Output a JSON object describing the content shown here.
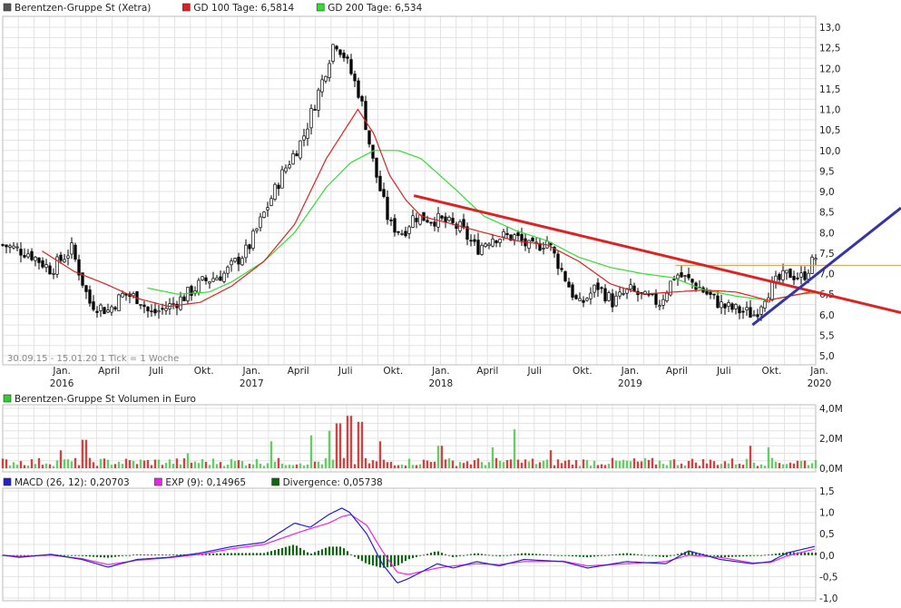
{
  "price_panel": {
    "legend": [
      {
        "label": "Berentzen-Gruppe St (Xetra)",
        "color": "#555555"
      },
      {
        "label": "GD 100 Tage: 6,5814",
        "color": "#e02020"
      },
      {
        "label": "GD 200 Tage: 6,534",
        "color": "#33dd33"
      }
    ],
    "y_ticks": [
      "13,0",
      "12,5",
      "12,0",
      "11,5",
      "11,0",
      "10,5",
      "10,0",
      "9,5",
      "9,0",
      "8,5",
      "8,0",
      "7,5",
      "7,0",
      "6,5",
      "6,0",
      "5,5",
      "5,0"
    ],
    "footer": "30.09.15 - 15.01.20   1 Tick = 1 Woche",
    "x_ticks": [
      {
        "label": "Jan.",
        "year": "2016"
      },
      {
        "label": "April",
        "year": ""
      },
      {
        "label": "Juli",
        "year": ""
      },
      {
        "label": "Okt.",
        "year": ""
      },
      {
        "label": "Jan.",
        "year": "2017"
      },
      {
        "label": "April",
        "year": ""
      },
      {
        "label": "Juli",
        "year": ""
      },
      {
        "label": "Okt.",
        "year": ""
      },
      {
        "label": "Jan.",
        "year": "2018"
      },
      {
        "label": "April",
        "year": ""
      },
      {
        "label": "Juli",
        "year": ""
      },
      {
        "label": "Okt.",
        "year": ""
      },
      {
        "label": "Jan.",
        "year": "2019"
      },
      {
        "label": "April",
        "year": ""
      },
      {
        "label": "Juli",
        "year": ""
      },
      {
        "label": "Okt.",
        "year": ""
      },
      {
        "label": "Jan.",
        "year": "2020"
      }
    ]
  },
  "volume_panel": {
    "legend": [
      {
        "label": "Berentzen-Gruppe St Volumen in Euro",
        "color": "#33cc33"
      }
    ],
    "y_ticks": [
      "4,0M",
      "2,0M",
      "0,0M"
    ]
  },
  "macd_panel": {
    "legend": [
      {
        "label": "MACD (26, 12): 0,20703",
        "color": "#2222cc"
      },
      {
        "label": "EXP (9): 0,14965",
        "color": "#ee22ee"
      },
      {
        "label": "Divergence: 0,05738",
        "color": "#116611"
      }
    ],
    "y_ticks": [
      "1,5",
      "1,0",
      "0,5",
      "0,0",
      "-0,5",
      "-1,0"
    ]
  },
  "chart_data": [
    {
      "type": "candlestick",
      "title": "Berentzen-Gruppe St (Xetra)",
      "x_range": [
        "2015-09-30",
        "2020-01-15"
      ],
      "ylim": [
        4.9,
        13.2
      ],
      "grid": true,
      "legend_position": "top-left",
      "series": [
        {
          "name": "Berentzen-Gruppe St (Xetra)",
          "kind": "weekly_candles",
          "color_up": "#ffffff",
          "color_down": "#000000",
          "close_anchors": [
            [
              "2015-09-30",
              7.7
            ],
            [
              "2015-11-20",
              7.5
            ],
            [
              "2016-01-01",
              7.1
            ],
            [
              "2016-02-10",
              7.6
            ],
            [
              "2016-03-15",
              6.3
            ],
            [
              "2016-04-20",
              6.1
            ],
            [
              "2016-05-20",
              6.5
            ],
            [
              "2016-06-20",
              6.4
            ],
            [
              "2016-07-10",
              6.0
            ],
            [
              "2016-08-15",
              6.2
            ],
            [
              "2016-09-10",
              6.4
            ],
            [
              "2016-10-20",
              6.8
            ],
            [
              "2016-12-01",
              7.0
            ],
            [
              "2017-01-15",
              7.6
            ],
            [
              "2017-02-20",
              8.6
            ],
            [
              "2017-03-25",
              9.5
            ],
            [
              "2017-05-01",
              10.3
            ],
            [
              "2017-06-10",
              11.8
            ],
            [
              "2017-07-01",
              12.7
            ],
            [
              "2017-07-20",
              12.3
            ],
            [
              "2017-08-20",
              11.3
            ],
            [
              "2017-09-15",
              9.6
            ],
            [
              "2017-10-15",
              8.2
            ],
            [
              "2017-11-10",
              8.0
            ],
            [
              "2017-12-01",
              8.4
            ],
            [
              "2018-01-20",
              8.3
            ],
            [
              "2018-03-01",
              8.1
            ],
            [
              "2018-04-01",
              7.6
            ],
            [
              "2018-05-01",
              7.9
            ],
            [
              "2018-06-15",
              7.9
            ],
            [
              "2018-07-15",
              7.6
            ],
            [
              "2018-08-15",
              7.8
            ],
            [
              "2018-09-15",
              7.0
            ],
            [
              "2018-10-15",
              6.2
            ],
            [
              "2018-11-20",
              6.7
            ],
            [
              "2018-12-20",
              6.3
            ],
            [
              "2019-01-20",
              6.6
            ],
            [
              "2019-02-20",
              6.4
            ],
            [
              "2019-03-20",
              6.3
            ],
            [
              "2019-04-20",
              7.0
            ],
            [
              "2019-05-20",
              6.8
            ],
            [
              "2019-06-20",
              6.5
            ],
            [
              "2019-07-20",
              6.2
            ],
            [
              "2019-08-20",
              6.1
            ],
            [
              "2019-09-20",
              6.0
            ],
            [
              "2019-10-10",
              6.5
            ],
            [
              "2019-11-01",
              6.8
            ],
            [
              "2019-11-25",
              7.0
            ],
            [
              "2019-12-20",
              6.9
            ],
            [
              "2020-01-15",
              7.4
            ]
          ]
        },
        {
          "name": "GD 100 Tage",
          "value_label": "6,5814",
          "color": "#e02020",
          "anchors": [
            [
              "2015-12-15",
              7.55
            ],
            [
              "2016-02-15",
              7.05
            ],
            [
              "2016-04-15",
              6.75
            ],
            [
              "2016-06-15",
              6.4
            ],
            [
              "2016-08-15",
              6.2
            ],
            [
              "2016-10-15",
              6.3
            ],
            [
              "2016-12-15",
              6.7
            ],
            [
              "2017-02-15",
              7.3
            ],
            [
              "2017-04-15",
              8.2
            ],
            [
              "2017-06-15",
              9.8
            ],
            [
              "2017-08-15",
              11.0
            ],
            [
              "2017-09-15",
              10.4
            ],
            [
              "2017-10-15",
              9.4
            ],
            [
              "2017-11-15",
              8.8
            ],
            [
              "2017-12-15",
              8.4
            ],
            [
              "2018-02-15",
              8.2
            ],
            [
              "2018-04-15",
              8.0
            ],
            [
              "2018-06-15",
              7.8
            ],
            [
              "2018-08-15",
              7.7
            ],
            [
              "2018-10-15",
              7.3
            ],
            [
              "2018-12-15",
              6.75
            ],
            [
              "2019-02-15",
              6.5
            ],
            [
              "2019-04-15",
              6.55
            ],
            [
              "2019-06-15",
              6.6
            ],
            [
              "2019-08-15",
              6.55
            ],
            [
              "2019-10-15",
              6.35
            ],
            [
              "2019-12-15",
              6.5
            ],
            [
              "2020-01-15",
              6.58
            ]
          ]
        },
        {
          "name": "GD 200 Tage",
          "value_label": "6,534",
          "color": "#33dd33",
          "anchors": [
            [
              "2016-07-05",
              6.65
            ],
            [
              "2016-09-01",
              6.5
            ],
            [
              "2016-11-01",
              6.55
            ],
            [
              "2016-12-15",
              6.8
            ],
            [
              "2017-02-15",
              7.3
            ],
            [
              "2017-04-15",
              8.0
            ],
            [
              "2017-06-15",
              9.1
            ],
            [
              "2017-08-01",
              9.7
            ],
            [
              "2017-09-15",
              10.0
            ],
            [
              "2017-11-01",
              10.0
            ],
            [
              "2017-12-15",
              9.8
            ],
            [
              "2018-02-15",
              9.1
            ],
            [
              "2018-04-15",
              8.4
            ],
            [
              "2018-06-15",
              8.05
            ],
            [
              "2018-08-15",
              7.8
            ],
            [
              "2018-10-15",
              7.4
            ],
            [
              "2018-12-15",
              7.15
            ],
            [
              "2019-02-15",
              7.0
            ],
            [
              "2019-04-15",
              6.9
            ],
            [
              "2019-06-15",
              6.6
            ],
            [
              "2019-08-15",
              6.45
            ],
            [
              "2019-10-15",
              6.35
            ],
            [
              "2019-12-15",
              6.5
            ],
            [
              "2020-01-15",
              6.53
            ]
          ]
        },
        {
          "name": "resistance",
          "kind": "trendline",
          "color": "#dd2222",
          "points": [
            [
              "2017-12-01",
              8.9
            ],
            [
              "2020-01-30",
              6.05
            ]
          ]
        },
        {
          "name": "support",
          "kind": "trendline",
          "color": "#3333aa",
          "points": [
            [
              "2019-09-15",
              5.75
            ],
            [
              "2020-01-30",
              8.6
            ]
          ]
        },
        {
          "name": "horizontal",
          "kind": "hline",
          "color": "#e8a060",
          "points": [
            [
              "2019-04-20",
              7.2
            ],
            [
              "2020-01-30",
              7.2
            ]
          ]
        }
      ]
    },
    {
      "type": "bar",
      "title": "Berentzen-Gruppe St Volumen in Euro",
      "ylim": [
        0,
        4.0
      ],
      "y_unit": "M EUR",
      "color_up": "#66cc66",
      "color_down": "#cc4444",
      "spikes": [
        [
          "2016-01-20",
          1.2
        ],
        [
          "2016-03-05",
          1.9
        ],
        [
          "2016-09-20",
          1.0
        ],
        [
          "2017-03-01",
          1.8
        ],
        [
          "2017-05-15",
          2.2
        ],
        [
          "2017-06-20",
          2.5
        ],
        [
          "2017-07-08",
          3.0
        ],
        [
          "2017-07-30",
          3.5
        ],
        [
          "2017-08-20",
          3.1
        ],
        [
          "2017-09-25",
          1.8
        ],
        [
          "2018-01-20",
          1.5
        ],
        [
          "2018-05-01",
          1.4
        ],
        [
          "2018-06-15",
          2.6
        ],
        [
          "2018-08-20",
          1.2
        ],
        [
          "2019-09-10",
          1.5
        ],
        [
          "2019-10-15",
          1.4
        ]
      ]
    },
    {
      "type": "line",
      "title": "MACD (26, 12)",
      "ylim": [
        -1.0,
        1.5
      ],
      "series": [
        {
          "name": "MACD (26, 12)",
          "value_label": "0,20703",
          "color": "#2222cc",
          "anchors": [
            [
              "2015-09-30",
              0.0
            ],
            [
              "2015-11-01",
              -0.05
            ],
            [
              "2016-01-01",
              0.02
            ],
            [
              "2016-03-01",
              -0.1
            ],
            [
              "2016-04-20",
              -0.28
            ],
            [
              "2016-06-15",
              -0.1
            ],
            [
              "2016-08-15",
              -0.05
            ],
            [
              "2016-10-15",
              0.05
            ],
            [
              "2016-12-15",
              0.2
            ],
            [
              "2017-02-15",
              0.3
            ],
            [
              "2017-04-15",
              0.75
            ],
            [
              "2017-05-15",
              0.65
            ],
            [
              "2017-06-20",
              0.95
            ],
            [
              "2017-07-15",
              1.1
            ],
            [
              "2017-07-30",
              1.0
            ],
            [
              "2017-09-01",
              0.5
            ],
            [
              "2017-10-01",
              -0.2
            ],
            [
              "2017-10-30",
              -0.65
            ],
            [
              "2017-11-20",
              -0.55
            ],
            [
              "2018-01-15",
              -0.2
            ],
            [
              "2018-02-15",
              -0.3
            ],
            [
              "2018-04-01",
              -0.15
            ],
            [
              "2018-05-15",
              -0.25
            ],
            [
              "2018-07-01",
              -0.1
            ],
            [
              "2018-09-15",
              -0.15
            ],
            [
              "2018-11-01",
              -0.3
            ],
            [
              "2019-01-15",
              -0.15
            ],
            [
              "2019-04-01",
              -0.2
            ],
            [
              "2019-05-15",
              0.1
            ],
            [
              "2019-07-15",
              -0.1
            ],
            [
              "2019-09-15",
              -0.2
            ],
            [
              "2019-10-20",
              -0.15
            ],
            [
              "2019-11-20",
              0.05
            ],
            [
              "2020-01-15",
              0.21
            ]
          ]
        },
        {
          "name": "EXP (9)",
          "value_label": "0,14965",
          "color": "#ee22ee",
          "anchors": [
            [
              "2015-09-30",
              0.0
            ],
            [
              "2015-11-01",
              -0.03
            ],
            [
              "2016-01-01",
              0.0
            ],
            [
              "2016-03-01",
              -0.08
            ],
            [
              "2016-04-20",
              -0.22
            ],
            [
              "2016-06-15",
              -0.12
            ],
            [
              "2016-08-15",
              -0.06
            ],
            [
              "2016-10-15",
              0.02
            ],
            [
              "2016-12-15",
              0.15
            ],
            [
              "2017-02-15",
              0.25
            ],
            [
              "2017-04-15",
              0.5
            ],
            [
              "2017-05-15",
              0.62
            ],
            [
              "2017-06-20",
              0.75
            ],
            [
              "2017-07-15",
              0.9
            ],
            [
              "2017-08-01",
              0.95
            ],
            [
              "2017-09-01",
              0.7
            ],
            [
              "2017-10-01",
              0.1
            ],
            [
              "2017-10-30",
              -0.4
            ],
            [
              "2017-11-20",
              -0.45
            ],
            [
              "2018-01-15",
              -0.3
            ],
            [
              "2018-02-15",
              -0.25
            ],
            [
              "2018-04-01",
              -0.2
            ],
            [
              "2018-05-15",
              -0.22
            ],
            [
              "2018-07-01",
              -0.15
            ],
            [
              "2018-09-15",
              -0.14
            ],
            [
              "2018-11-01",
              -0.25
            ],
            [
              "2019-01-15",
              -0.2
            ],
            [
              "2019-04-01",
              -0.15
            ],
            [
              "2019-05-15",
              0.0
            ],
            [
              "2019-07-15",
              -0.05
            ],
            [
              "2019-09-15",
              -0.18
            ],
            [
              "2019-10-20",
              -0.17
            ],
            [
              "2019-11-20",
              -0.02
            ],
            [
              "2020-01-15",
              0.15
            ]
          ]
        },
        {
          "name": "Divergence",
          "value_label": "0,05738",
          "color": "#116611",
          "kind": "histogram",
          "derived": "MACD - EXP"
        }
      ]
    }
  ]
}
